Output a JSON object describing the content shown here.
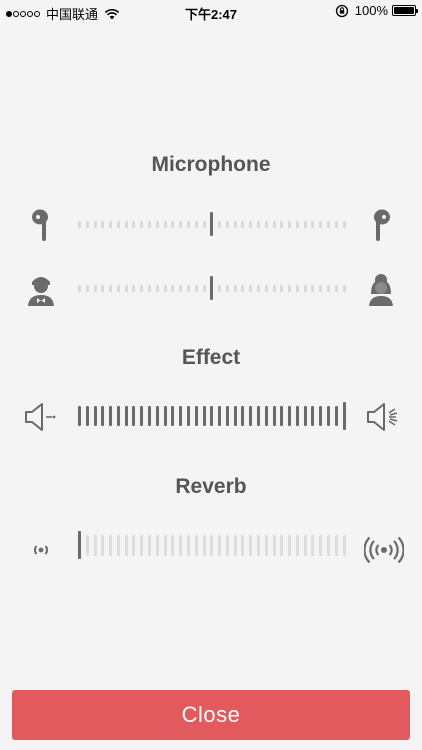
{
  "status_bar": {
    "carrier": "中国联通",
    "time": "下午2:47",
    "battery": "100%"
  },
  "sections": {
    "microphone_title": "Microphone",
    "effect_title": "Effect",
    "reverb_title": "Reverb"
  },
  "sliders": {
    "mic_pan": {
      "value": 0.5,
      "left_icon": "left-earbud-icon",
      "right_icon": "right-earbud-icon"
    },
    "mic_voice": {
      "value": 0.5,
      "left_icon": "male-avatar-icon",
      "right_icon": "female-avatar-icon"
    },
    "effect": {
      "value": 1.0,
      "left_icon": "speaker-low-icon",
      "right_icon": "speaker-high-icon"
    },
    "reverb": {
      "value": 0.0,
      "left_icon": "reverb-low-icon",
      "right_icon": "reverb-high-icon"
    }
  },
  "close_label": "Close"
}
